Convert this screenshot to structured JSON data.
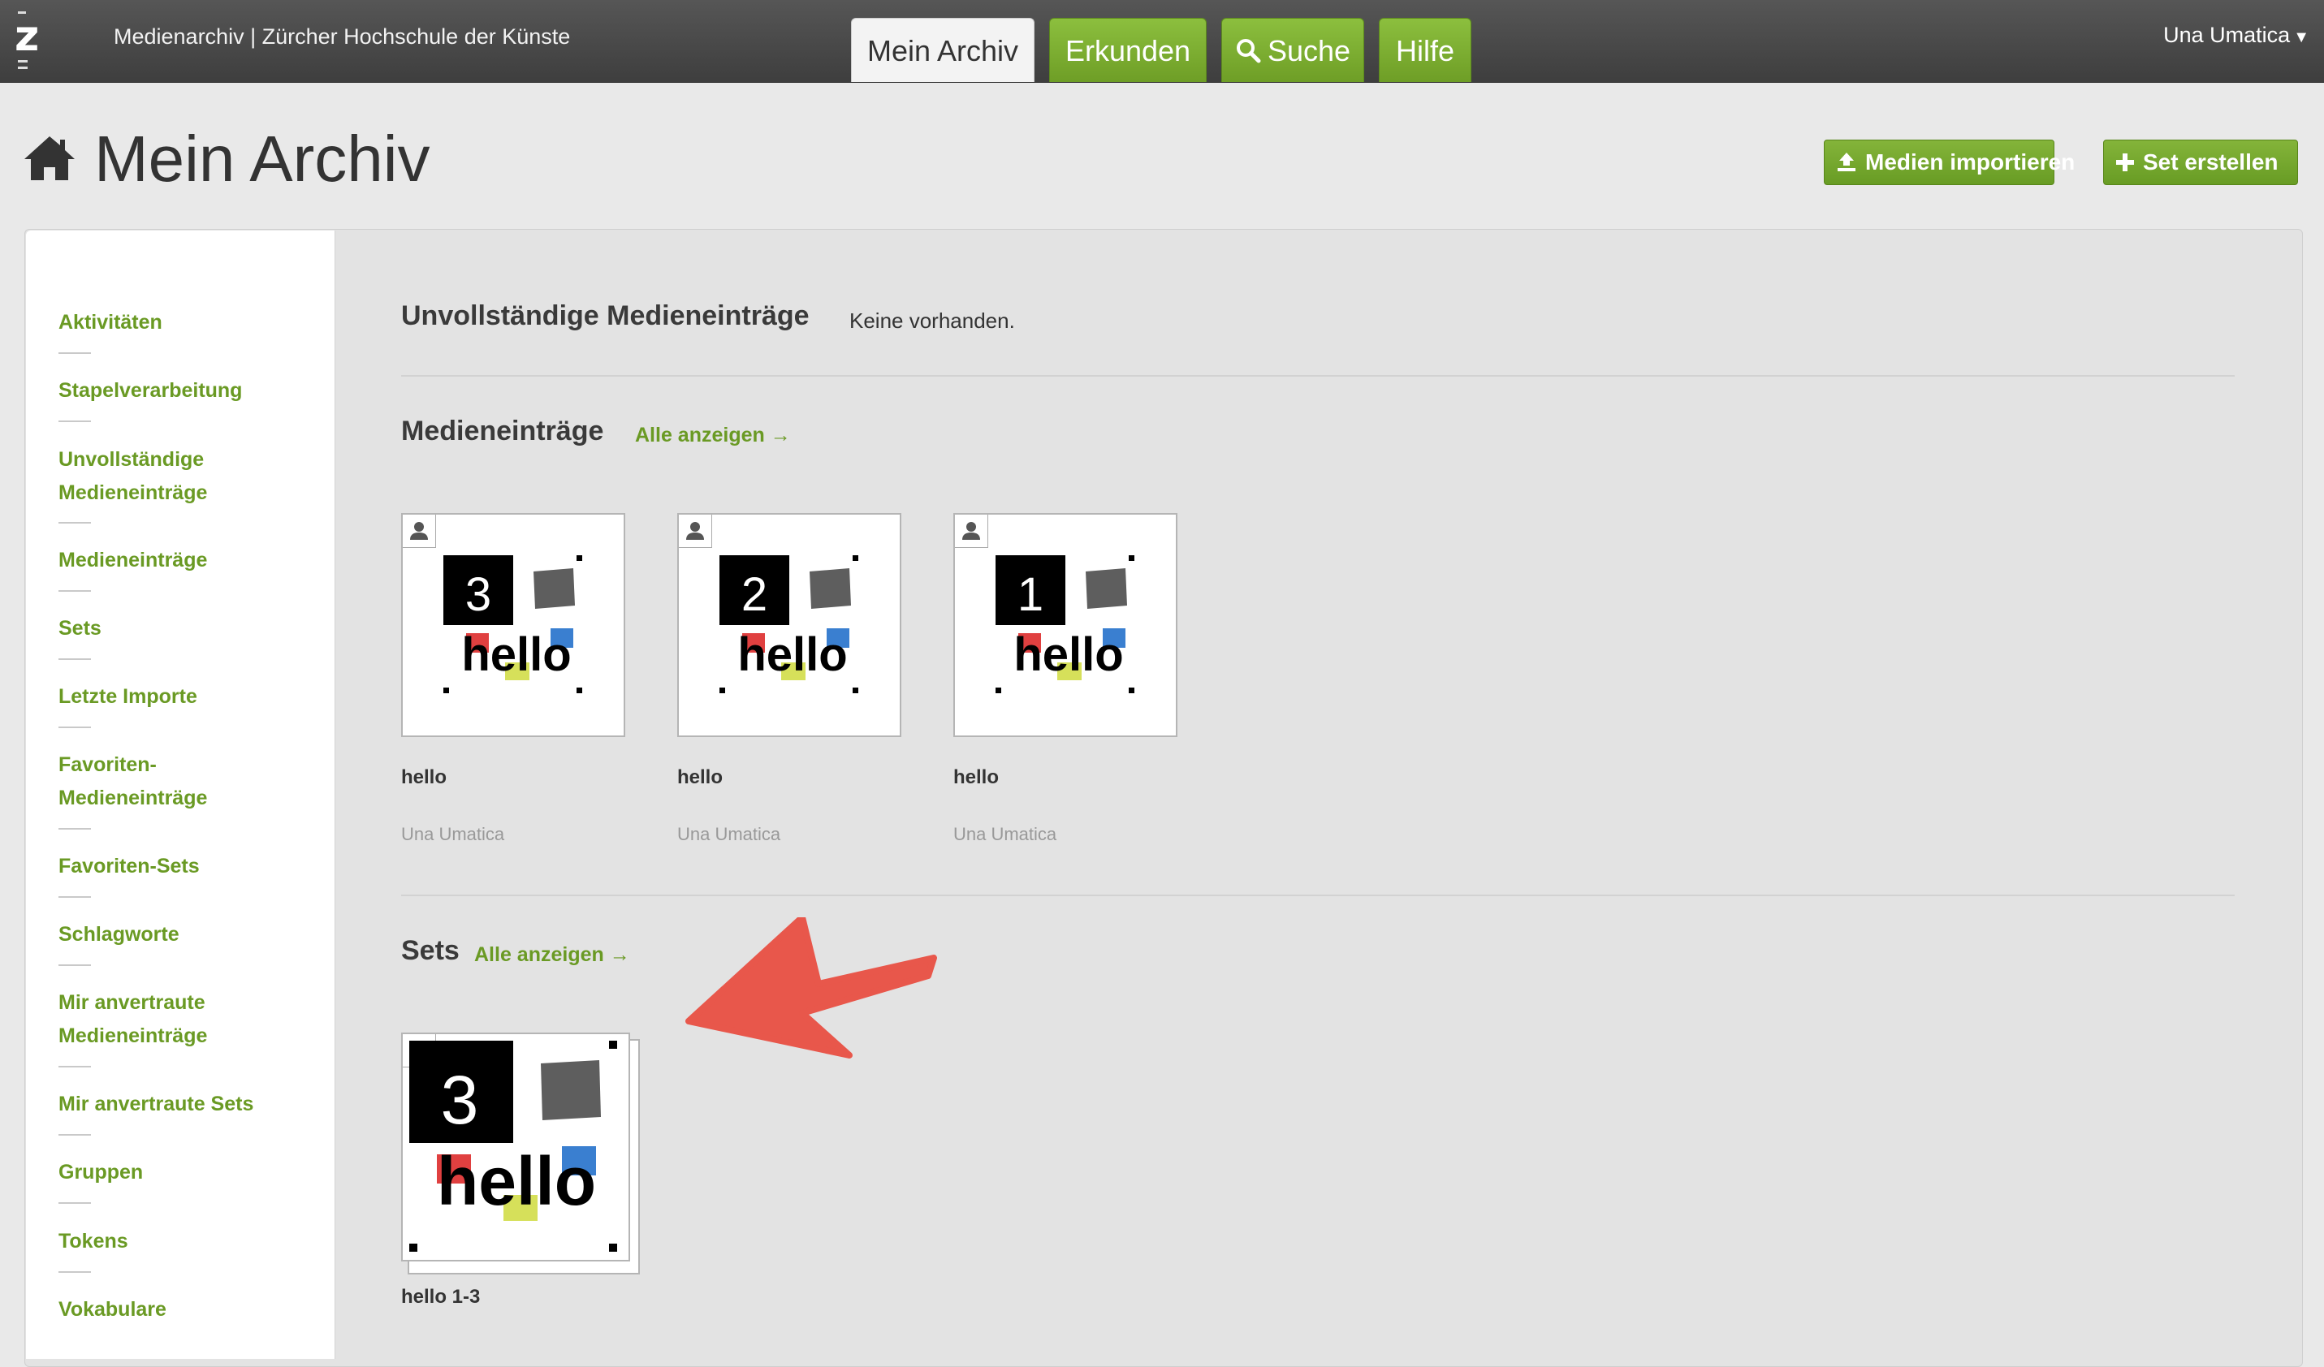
{
  "topbar": {
    "site_title": "Medienarchiv | Zürcher Hochschule der Künste",
    "tabs": [
      "Mein Archiv",
      "Erkunden",
      "Suche",
      "Hilfe"
    ],
    "user": "Una Umatica"
  },
  "header": {
    "title": "Mein Archiv",
    "import_label": "Medien importieren",
    "create_set_label": "Set erstellen"
  },
  "sidebar": {
    "items": [
      "Aktivitäten",
      "Stapelverarbeitung",
      "Unvollständige",
      "Medieneinträge",
      "Medieneinträge",
      "Sets",
      "Letzte Importe",
      "Favoriten-",
      "Medieneinträge",
      "Favoriten-Sets",
      "Schlagworte",
      "Mir anvertraute",
      "Medieneinträge",
      "Mir anvertraute Sets",
      "Gruppen",
      "Tokens",
      "Vokabulare"
    ]
  },
  "main": {
    "incomplete_title": "Unvollständige Medieneinträge",
    "incomplete_note": "Keine vorhanden.",
    "media_title": "Medieneinträge",
    "show_all": "Alle anzeigen →",
    "media": [
      {
        "number": "3",
        "art_text": "hello",
        "title": "hello",
        "author": "Una Umatica"
      },
      {
        "number": "2",
        "art_text": "hello",
        "title": "hello",
        "author": "Una Umatica"
      },
      {
        "number": "1",
        "art_text": "hello",
        "title": "hello",
        "author": "Una Umatica"
      }
    ],
    "sets_title": "Sets",
    "sets_show_all": "Alle anzeigen →",
    "sets": [
      {
        "number": "3",
        "art_text": "hello",
        "title": "hello 1-3"
      }
    ]
  },
  "colors": {
    "accent_green": "#6a9a24",
    "arrow": "#e8574b",
    "topbar": "#4a4a4a"
  }
}
